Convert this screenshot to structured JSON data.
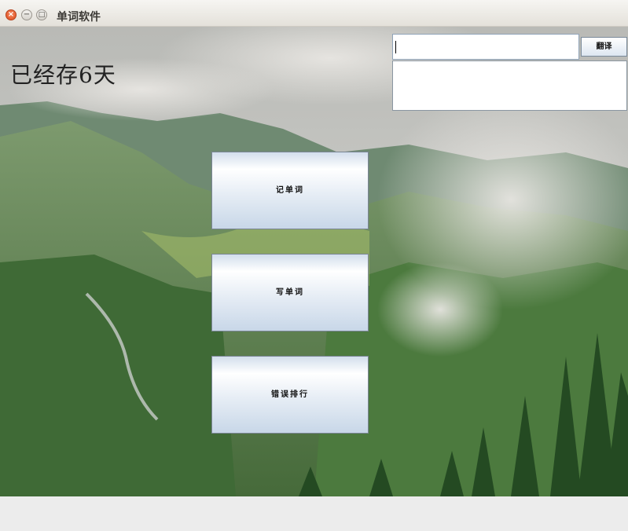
{
  "window": {
    "title": "单词软件",
    "close_symbol": "×",
    "minimize_symbol": "−",
    "maximize_symbol": "□"
  },
  "days_label": "已经存6天",
  "translate": {
    "input_value": "",
    "button_label": "翻译",
    "output_text": ""
  },
  "menu": {
    "memorize_label": "记单词",
    "write_label": "写单词",
    "mistakes_label": "错误排行"
  },
  "colors": {
    "button_gradient_top": "#ffffff",
    "button_gradient_bottom": "#c8d7e8",
    "close_button": "#df4b1c"
  },
  "icons": [
    "close-icon",
    "minimize-icon",
    "maximize-icon"
  ]
}
